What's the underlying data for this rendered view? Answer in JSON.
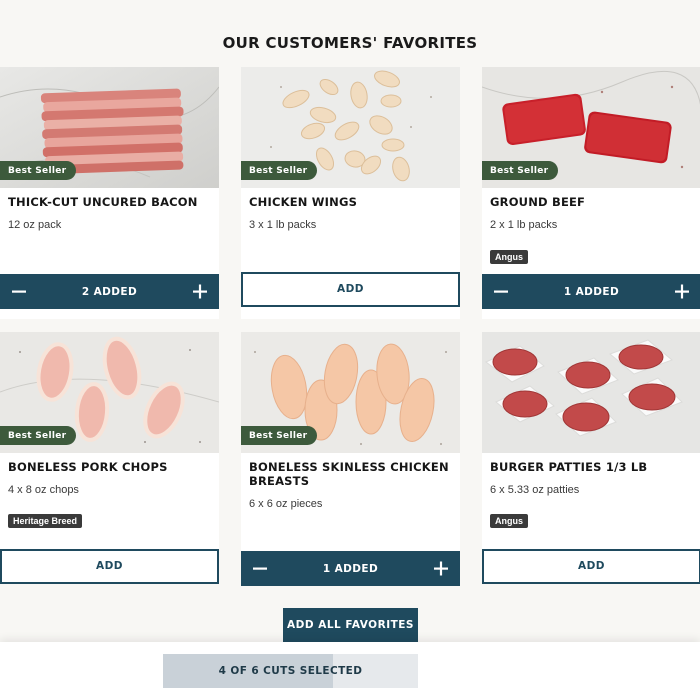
{
  "section": {
    "title": "Our Customers' Favorites"
  },
  "products": [
    {
      "name": "Thick-cut uncured bacon",
      "size": "12 oz pack",
      "badge": "Best Seller",
      "tag": "",
      "added_label": "2 Added",
      "quantity": 2
    },
    {
      "name": "Chicken Wings",
      "size": "3 x 1 lb packs",
      "badge": "Best Seller",
      "tag": "",
      "add_label": "Add",
      "quantity": 0
    },
    {
      "name": "Ground Beef",
      "size": "2 x 1 lb packs",
      "badge": "Best Seller",
      "tag": "Angus",
      "added_label": "1 Added",
      "quantity": 1
    },
    {
      "name": "Boneless Pork Chops",
      "size": "4 x 8 oz chops",
      "badge": "Best Seller",
      "tag": "Heritage Breed",
      "add_label": "Add",
      "quantity": 0
    },
    {
      "name": "Boneless Skinless Chicken Breasts",
      "size": "6 x 6 oz pieces",
      "badge": "Best Seller",
      "tag": "",
      "added_label": "1 Added",
      "quantity": 1
    },
    {
      "name": "Burger Patties 1/3 lb",
      "size": "6 x 5.33 oz patties",
      "badge": "",
      "tag": "Angus",
      "add_label": "Add",
      "quantity": 0
    }
  ],
  "controls": {
    "minus_icon": "minus-icon",
    "plus_icon": "plus-icon"
  },
  "add_all": {
    "label": "Add all favorites"
  },
  "footer": {
    "progress_label": "4 of 6 cuts selected",
    "progress_fraction": 0.667
  },
  "colors": {
    "primary": "#1f4a5e",
    "badge": "#3d5a3c",
    "tag": "#3a3a3a",
    "background": "#f8f7f4"
  }
}
